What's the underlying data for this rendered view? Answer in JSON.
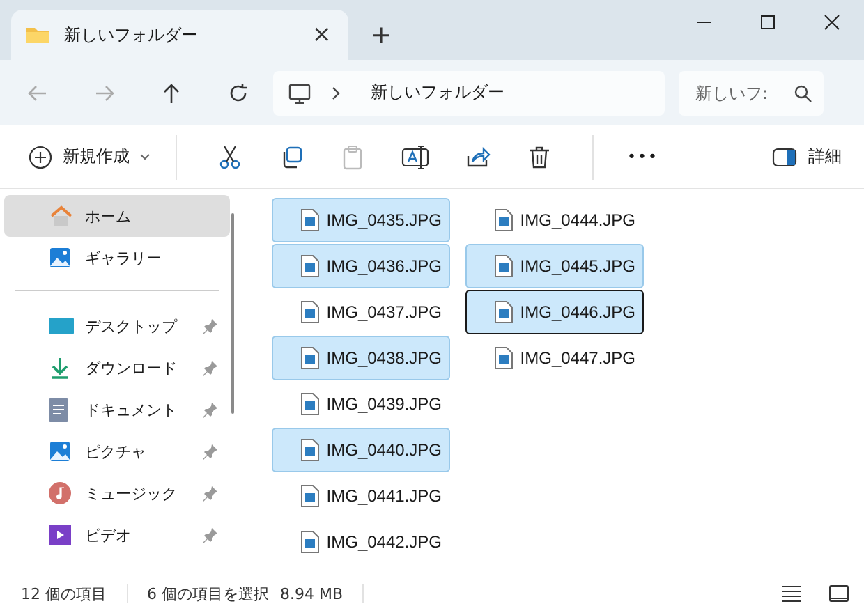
{
  "window": {
    "tab_title": "新しいフォルダー",
    "tab_close": "×",
    "new_tab": "+"
  },
  "address": {
    "path": "新しいフォルダー",
    "search_placeholder": "新しいフ:"
  },
  "toolbar": {
    "new_label": "新規作成",
    "more": "•••",
    "details": "詳細"
  },
  "sidebar": {
    "items": [
      {
        "label": "ホーム",
        "selected": true,
        "pinned": false
      },
      {
        "label": "ギャラリー",
        "selected": false,
        "pinned": false
      },
      {
        "label": "デスクトップ",
        "selected": false,
        "pinned": true
      },
      {
        "label": "ダウンロード",
        "selected": false,
        "pinned": true
      },
      {
        "label": "ドキュメント",
        "selected": false,
        "pinned": true
      },
      {
        "label": "ピクチャ",
        "selected": false,
        "pinned": true
      },
      {
        "label": "ミュージック",
        "selected": false,
        "pinned": true
      },
      {
        "label": "ビデオ",
        "selected": false,
        "pinned": true
      }
    ]
  },
  "files": {
    "columns": [
      [
        {
          "name": "IMG_0435.JPG",
          "selected": true,
          "focused": false
        },
        {
          "name": "IMG_0436.JPG",
          "selected": true,
          "focused": false
        },
        {
          "name": "IMG_0437.JPG",
          "selected": false,
          "focused": false
        },
        {
          "name": "IMG_0438.JPG",
          "selected": true,
          "focused": false
        },
        {
          "name": "IMG_0439.JPG",
          "selected": false,
          "focused": false
        },
        {
          "name": "IMG_0440.JPG",
          "selected": true,
          "focused": false
        },
        {
          "name": "IMG_0441.JPG",
          "selected": false,
          "focused": false
        },
        {
          "name": "IMG_0442.JPG",
          "selected": false,
          "focused": false
        }
      ],
      [
        {
          "name": "IMG_0444.JPG",
          "selected": false,
          "focused": false
        },
        {
          "name": "IMG_0445.JPG",
          "selected": true,
          "focused": false
        },
        {
          "name": "IMG_0446.JPG",
          "selected": true,
          "focused": true
        },
        {
          "name": "IMG_0447.JPG",
          "selected": false,
          "focused": false
        }
      ]
    ]
  },
  "status_bar": {
    "count": "12 個の項目",
    "selection": "6 個の項目を選択",
    "size": "8.94 MB"
  }
}
